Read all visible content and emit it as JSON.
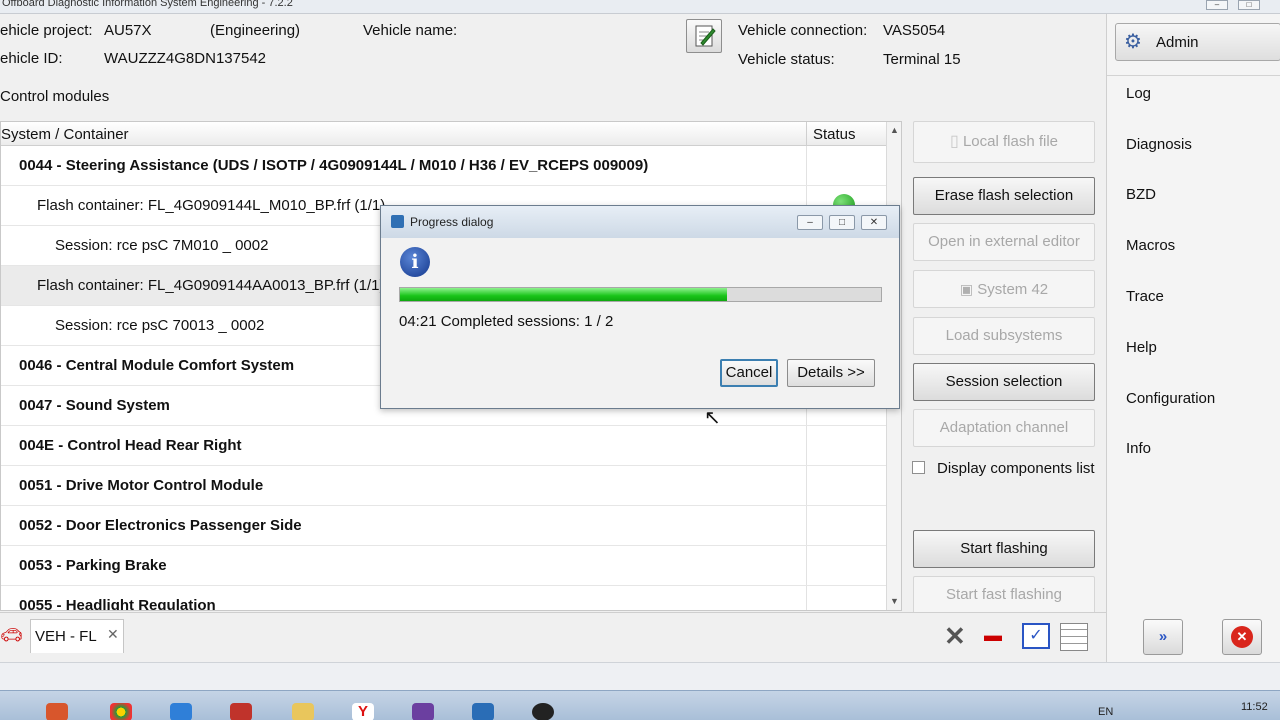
{
  "window": {
    "title": "Offboard Diagnostic Information System Engineering - 7.2.2"
  },
  "header": {
    "vehicle_project_label": "ehicle project:",
    "vehicle_project_value": "AU57X",
    "vehicle_project_mode": "(Engineering)",
    "vehicle_name_label": "Vehicle name:",
    "vehicle_id_label": "ehicle ID:",
    "vehicle_id_value": "WAUZZZ4G8DN137542",
    "vehicle_connection_label": "Vehicle connection:",
    "vehicle_connection_value": "VAS5054",
    "vehicle_status_label": "Vehicle status:",
    "vehicle_status_value": "Terminal 15"
  },
  "control_modules": {
    "title": "Control modules",
    "col_system": "System / Container",
    "col_status": "Status",
    "rows": [
      {
        "text": "0044 - Steering Assistance  (UDS / ISOTP / 4G0909144L / M010 / H36 / EV_RCEPS 009009)",
        "level": 0
      },
      {
        "text": "Flash container: FL_4G0909144L_M010_BP.frf (1/1)",
        "level": 1
      },
      {
        "text": "Session: rce psC 7M010 _ 0002",
        "level": 2
      },
      {
        "text": "Flash container: FL_4G0909144AA0013_BP.frf (1/1)",
        "level": 1
      },
      {
        "text": "Session: rce psC 70013 _ 0002",
        "level": 2
      },
      {
        "text": "0046 - Central Module Comfort System",
        "level": 0
      },
      {
        "text": "0047 - Sound System",
        "level": 0
      },
      {
        "text": "004E - Control Head Rear Right",
        "level": 0
      },
      {
        "text": "0051 - Drive Motor Control Module",
        "level": 0
      },
      {
        "text": "0052 - Door Electronics Passenger Side",
        "level": 0
      },
      {
        "text": "0053 - Parking Brake",
        "level": 0
      },
      {
        "text": "0055 - Headlight Regulation",
        "level": 0
      }
    ]
  },
  "actions": {
    "local_flash_file": "Local flash file",
    "erase_flash_selection": "Erase flash selection",
    "open_external_editor": "Open in external editor",
    "system42": "System 42",
    "load_subsystems": "Load subsystems",
    "session_selection": "Session selection",
    "adaptation_channel": "Adaptation channel",
    "display_components_list": "Display components list",
    "start_flashing": "Start flashing",
    "start_fast_flashing": "Start fast flashing"
  },
  "sidebar": {
    "admin": "Admin",
    "items": [
      "Log",
      "Diagnosis",
      "BZD",
      "Macros",
      "Trace",
      "Help",
      "Configuration",
      "Info"
    ]
  },
  "bottom": {
    "tab_label": "VEH - FL"
  },
  "dialog": {
    "title": "Progress dialog",
    "status_text": "04:21  Completed sessions: 1 / 2",
    "progress_fraction": 0.68,
    "cancel": "Cancel",
    "details": "Details >>"
  },
  "taskbar": {
    "lang": "EN",
    "time": "11:52"
  },
  "colors": {
    "progress": "#19c419",
    "close": "#d9261c",
    "accent_blue": "#2f6fb4"
  }
}
